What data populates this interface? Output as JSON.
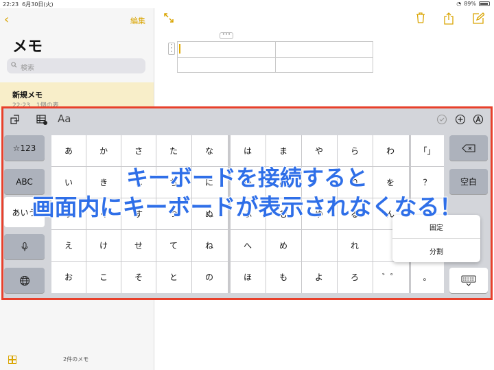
{
  "status": {
    "time": "22:23",
    "date": "6月30日(火)",
    "battery": "89%"
  },
  "sidebar": {
    "edit_label": "編集",
    "title": "メモ",
    "search_placeholder": "検索",
    "note_title": "新規メモ",
    "note_sub": "22:23　1個の表",
    "count": "2件のメモ"
  },
  "keyboard": {
    "toolbar": {
      "format_label": "Aa"
    },
    "left_keys": [
      "☆123",
      "ABC",
      "あいう"
    ],
    "main_cols": [
      [
        "あ",
        "い",
        "う",
        "え",
        "お"
      ],
      [
        "か",
        "き",
        "く",
        "け",
        "こ"
      ],
      [
        "さ",
        "し",
        "す",
        "せ",
        "そ"
      ],
      [
        "た",
        "ち",
        "つ",
        "て",
        "と"
      ],
      [
        "な",
        "に",
        "ぬ",
        "ね",
        "の"
      ],
      [
        "は",
        "ひ",
        "ふ",
        "へ",
        "ほ"
      ],
      [
        "ま",
        "み",
        "む",
        "め",
        "も"
      ],
      [
        "や",
        "",
        "ゆ",
        "",
        "よ"
      ],
      [
        "ら",
        "り",
        "る",
        "れ",
        "ろ"
      ],
      [
        "わ",
        "を",
        "ん",
        "",
        "゛゜"
      ]
    ],
    "punct": [
      "「」",
      "？",
      "",
      "",
      "。"
    ],
    "space_label": "空白",
    "popup": {
      "fixed": "固定",
      "split": "分割"
    }
  },
  "overlay": {
    "line1": "キーボードを接続すると",
    "line2": "画面内にキーボードが表示されなくなる！"
  }
}
